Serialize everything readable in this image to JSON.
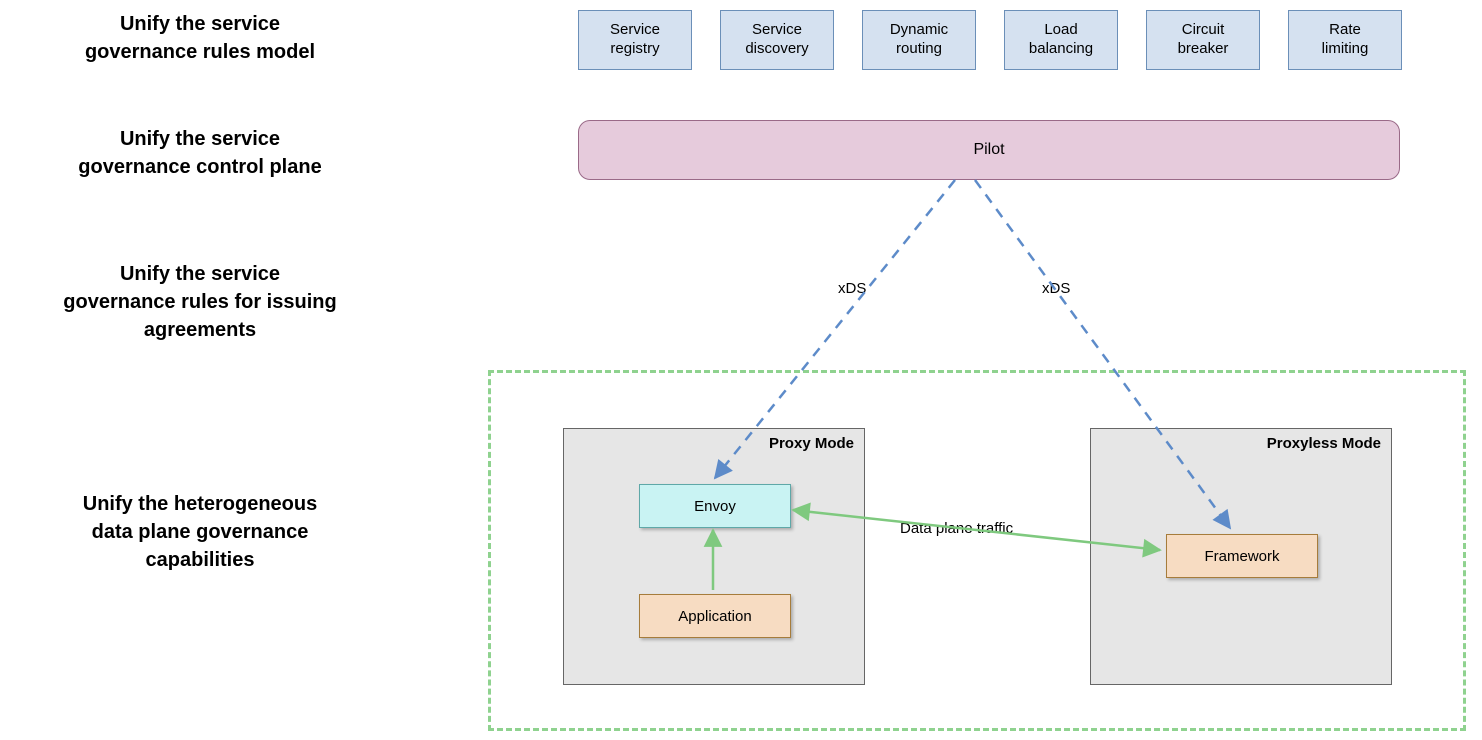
{
  "row_labels": {
    "rules_model": "Unify the service\ngovernance rules model",
    "control_plane": "Unify the service\ngovernance control plane",
    "issuing": "Unify the service\ngovernance rules for issuing\nagreements",
    "data_plane": "Unify the heterogeneous\ndata plane governance\ncapabilities"
  },
  "capabilities": [
    "Service\nregistry",
    "Service\ndiscovery",
    "Dynamic\nrouting",
    "Load\nbalancing",
    "Circuit\nbreaker",
    "Rate\nlimiting"
  ],
  "pilot": "Pilot",
  "proxy_mode_title": "Proxy Mode",
  "proxyless_mode_title": "Proxyless Mode",
  "envoy": "Envoy",
  "application": "Application",
  "framework": "Framework",
  "xds_left": "xDS",
  "xds_right": "xDS",
  "traffic": "Data plane traffic"
}
